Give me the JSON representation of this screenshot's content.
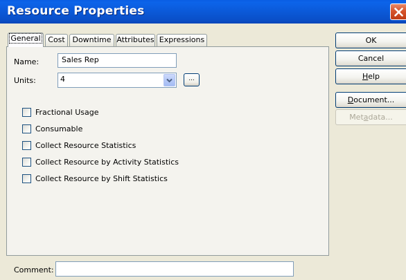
{
  "window": {
    "title": "Resource Properties",
    "close_icon": "close-icon",
    "accent": "#0a5de3",
    "close_color": "#d6542c"
  },
  "tabs": [
    {
      "label": "General",
      "active": true
    },
    {
      "label": "Cost",
      "active": false
    },
    {
      "label": "Downtime",
      "active": false
    },
    {
      "label": "Attributes",
      "active": false
    },
    {
      "label": "Expressions",
      "active": false
    }
  ],
  "general": {
    "name_label": "Name:",
    "name_value": "Sales Rep",
    "units_label": "Units:",
    "units_value": "4",
    "units_browse_label": "...",
    "checkboxes": [
      {
        "label": "Fractional Usage",
        "checked": false
      },
      {
        "label": "Consumable",
        "checked": false
      },
      {
        "label": "Collect Resource Statistics",
        "checked": false
      },
      {
        "label": "Collect Resource by Activity Statistics",
        "checked": false
      },
      {
        "label": "Collect Resource by Shift Statistics",
        "checked": false
      }
    ]
  },
  "comment": {
    "label": "Comment:",
    "value": ""
  },
  "buttons": {
    "ok": "OK",
    "cancel": "Cancel",
    "help_mnemonic": "H",
    "help_rest": "elp",
    "document_mnemonic": "D",
    "document_rest": "ocument...",
    "metadata_pre": "Met",
    "metadata_mnemonic": "a",
    "metadata_rest": "data..."
  }
}
